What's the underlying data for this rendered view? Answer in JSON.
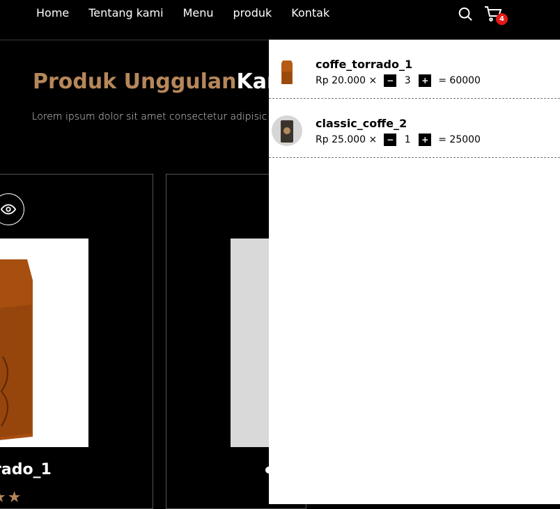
{
  "nav": {
    "links": [
      "Home",
      "Tentang kami",
      "Menu",
      "produk",
      "Kontak"
    ],
    "cart_count": "4"
  },
  "main": {
    "title_accent": "Produk Unggulan",
    "title_rest": "Kam",
    "description": "Lorem ipsum dolor sit amet consectetur adipisic elit."
  },
  "products": [
    {
      "name": "rado_1",
      "stars": "★★"
    },
    {
      "name": "",
      "stars": ""
    }
  ],
  "cart": {
    "items": [
      {
        "name": "coffe_torrado_1",
        "price": "Rp 20.000 ×",
        "minus": "−",
        "qty": "3",
        "plus": "+",
        "total": "= 60000"
      },
      {
        "name": "classic_coffe_2",
        "price": "Rp 25.000 ×",
        "minus": "−",
        "qty": "1",
        "plus": "+",
        "total": "= 25000"
      }
    ]
  },
  "colors": {
    "accent": "#b6875a",
    "badge": "#e31818",
    "background": "#000000"
  }
}
